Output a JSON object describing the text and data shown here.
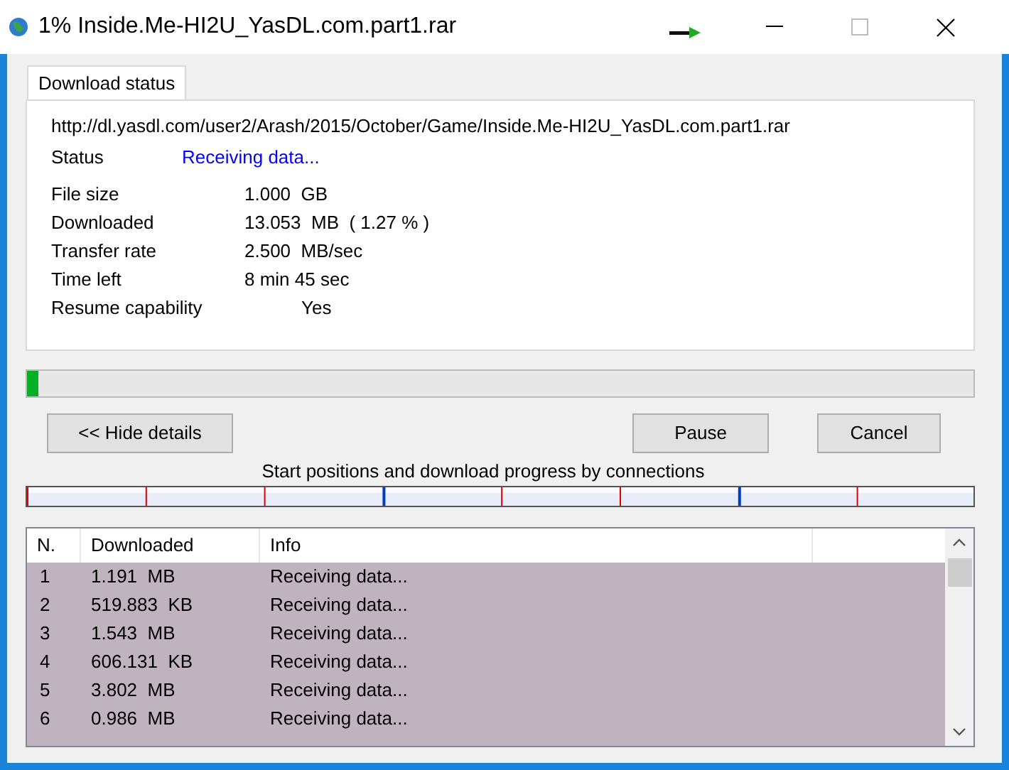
{
  "window": {
    "title": "1% Inside.Me-HI2U_YasDL.com.part1.rar"
  },
  "tabs": [
    {
      "label": "Download status",
      "selected": true
    }
  ],
  "url": "http://dl.yasdl.com/user2/Arash/2015/October/Game/Inside.Me-HI2U_YasDL.com.part1.rar",
  "status": {
    "label": "Status",
    "value": "Receiving data..."
  },
  "details": [
    {
      "label": "File size",
      "value": "1.000  GB"
    },
    {
      "label": "Downloaded",
      "value": "13.053  MB  ( 1.27 % )"
    },
    {
      "label": "Transfer rate",
      "value": "2.500  MB/sec"
    },
    {
      "label": "Time left",
      "value": "8 min 45 sec"
    },
    {
      "label": "Resume capability",
      "value": "Yes",
      "kind": "indented"
    }
  ],
  "progress": {
    "level": 0.0127
  },
  "buttons": {
    "details": "<< Hide details",
    "pause": "Pause",
    "cancel": "Cancel"
  },
  "connections_caption": "Start positions and download progress by connections",
  "table": {
    "columns": [
      "N.",
      "Downloaded",
      "Info"
    ],
    "rows": [
      {
        "n": "1",
        "downloaded": "1.191  MB",
        "info": "Receiving data..."
      },
      {
        "n": "2",
        "downloaded": "519.883  KB",
        "info": "Receiving data..."
      },
      {
        "n": "3",
        "downloaded": "1.543  MB",
        "info": "Receiving data..."
      },
      {
        "n": "4",
        "downloaded": "606.131  KB",
        "info": "Receiving data..."
      },
      {
        "n": "5",
        "downloaded": "3.802  MB",
        "info": "Receiving data..."
      },
      {
        "n": "6",
        "downloaded": "0.986  MB",
        "info": "Receiving data..."
      }
    ]
  }
}
